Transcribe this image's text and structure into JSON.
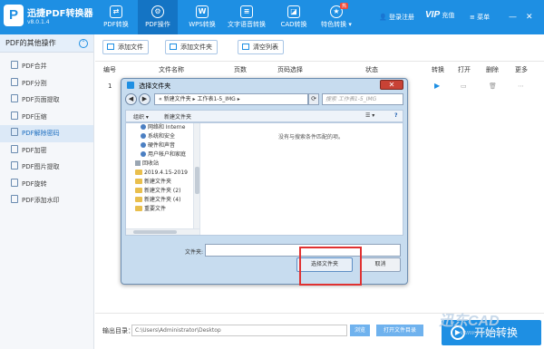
{
  "app": {
    "name": "迅捷PDF转换器",
    "version": "v8.0.1.4",
    "logo": "P"
  },
  "nav_tabs": [
    {
      "label": "PDF转换",
      "icon": "convert-icon",
      "active": false
    },
    {
      "label": "PDF操作",
      "icon": "pdf-operate-icon",
      "active": true
    },
    {
      "label": "WPS转换",
      "icon": "wps-icon",
      "active": false
    },
    {
      "label": "文字语音转换",
      "icon": "audio-icon",
      "active": false
    },
    {
      "label": "CAD转换",
      "icon": "cad-icon",
      "active": false
    },
    {
      "label": "特色转换",
      "icon": "special-icon",
      "active": false,
      "badge": "热",
      "has_dropdown": true
    }
  ],
  "top_right": {
    "login": "登录注册",
    "vip_logo": "VIP",
    "vip_label": "充值",
    "menu": "菜单"
  },
  "sidebar": {
    "header": "PDF的其他操作",
    "items": [
      {
        "label": "PDF合并",
        "active": false
      },
      {
        "label": "PDF分割",
        "active": false
      },
      {
        "label": "PDF页面提取",
        "active": false
      },
      {
        "label": "PDF压缩",
        "active": false
      },
      {
        "label": "PDF解除密码",
        "active": true
      },
      {
        "label": "PDF加密",
        "active": false
      },
      {
        "label": "PDF图片提取",
        "active": false
      },
      {
        "label": "PDF旋转",
        "active": false
      },
      {
        "label": "PDF添加水印",
        "active": false
      }
    ]
  },
  "toolbar": {
    "add_file": "添加文件",
    "add_folder": "添加文件夹",
    "clear_list": "清空列表"
  },
  "table": {
    "headers": [
      "编号",
      "文件名称",
      "页数",
      "页码选择",
      "状态",
      "转换",
      "打开",
      "删除",
      "更多"
    ],
    "row_index": "1"
  },
  "dialog": {
    "title": "选择文件夹",
    "path_prefix": "«",
    "path_segments": [
      "新建文件夹",
      "工作表1-5_IMG"
    ],
    "search_placeholder": "搜索 工作表1-5_IMG",
    "organize": "组织 ▾",
    "new_folder": "新建文件夹",
    "tree": [
      {
        "label": "网络和 Interne",
        "icon": "network-icon",
        "indent": 1
      },
      {
        "label": "系统和安全",
        "icon": "shield-icon",
        "indent": 1
      },
      {
        "label": "硬件和声音",
        "icon": "hardware-icon",
        "indent": 1
      },
      {
        "label": "用户帐户和家庭",
        "icon": "user-icon",
        "indent": 1
      },
      {
        "label": "回收站",
        "icon": "recycle-bin-icon",
        "indent": 0
      },
      {
        "label": "2019.4.15-2019",
        "icon": "folder-icon",
        "indent": 0
      },
      {
        "label": "新建文件夹",
        "icon": "folder-icon",
        "indent": 0
      },
      {
        "label": "新建文件夹 (2)",
        "icon": "folder-icon",
        "indent": 0
      },
      {
        "label": "新建文件夹 (4)",
        "icon": "folder-icon",
        "indent": 0
      },
      {
        "label": "重要文件",
        "icon": "folder-icon",
        "indent": 0
      }
    ],
    "empty_message": "没有与搜索条件匹配的项。",
    "folder_label": "文件夹:",
    "select_button": "选择文件夹",
    "cancel_button": "取消"
  },
  "footer": {
    "output_label": "输出目录：",
    "output_path": "C:\\Users\\Administrator\\Desktop",
    "browse": "浏览",
    "open_folder": "打开文件目录",
    "convert": "开始转换"
  },
  "watermark": {
    "line1": "迅东CAD",
    "line2": "www.xdcad.net"
  },
  "colors": {
    "accent": "#1e8fe3",
    "highlight": "#e03131"
  }
}
